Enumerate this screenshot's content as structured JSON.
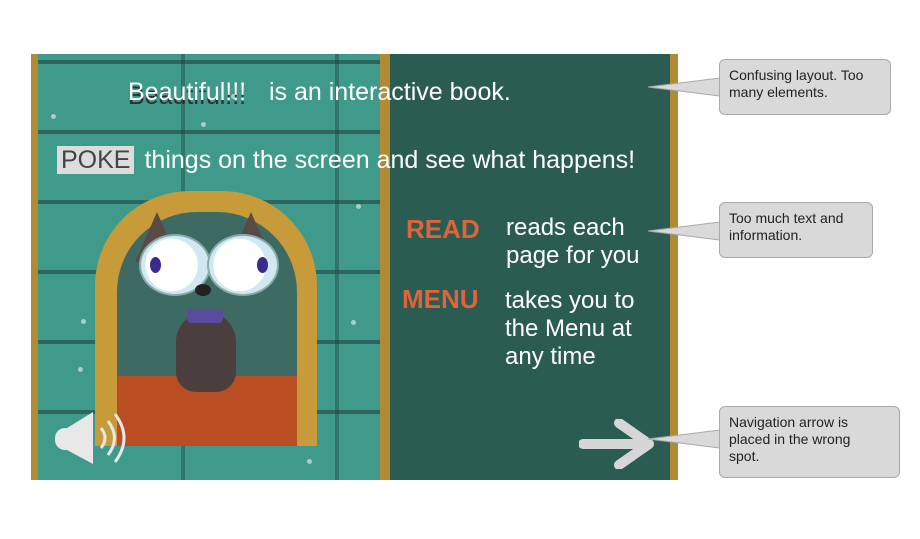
{
  "book": {
    "title_word": "Beautiful!!!",
    "title_rest": "is an interactive book.",
    "poke_label": "POKE",
    "poke_text": "things on the screen and see what happens!",
    "read_label": "READ",
    "read_desc_line1": "reads each",
    "read_desc_line2": "page for you",
    "menu_label": "MENU",
    "menu_desc_line1": "takes you to",
    "menu_desc_line2": "the Menu at",
    "menu_desc_line3": "any time",
    "icons": [
      "speaker-icon",
      "next-arrow-icon",
      "cat-illustration"
    ],
    "colors": {
      "accent": "#e0633a",
      "right_page": "#2b5c52",
      "wall": "#3f9a8b",
      "frame": "#b08a34"
    }
  },
  "annotations": [
    {
      "text_line1": "Confusing layout. Too",
      "text_line2": "many elements."
    },
    {
      "text_line1": "Too much text and",
      "text_line2": "information."
    },
    {
      "text_line1": "Navigation arrow is",
      "text_line2": "placed in the wrong",
      "text_line3": "spot."
    }
  ]
}
